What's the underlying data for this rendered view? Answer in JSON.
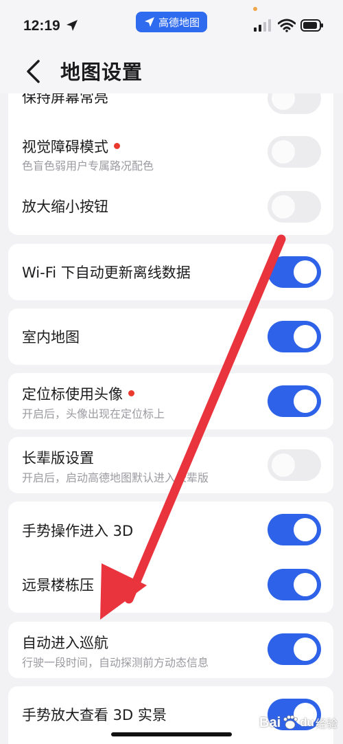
{
  "status": {
    "time": "12:19",
    "app_badge": "高德地图"
  },
  "header": {
    "title": "地图设置"
  },
  "settings": {
    "keep_screen_on": {
      "title": "保持屏幕常亮",
      "enabled": false
    },
    "visual_impairment": {
      "title": "视觉障碍模式",
      "subtitle": "色盲色弱用户专属路况配色",
      "enabled": false,
      "new_dot": true
    },
    "zoom_buttons": {
      "title": "放大缩小按钮",
      "enabled": false
    },
    "wifi_offline_update": {
      "title": "Wi-Fi 下自动更新离线数据",
      "enabled": true
    },
    "indoor_map": {
      "title": "室内地图",
      "enabled": true
    },
    "avatar_location": {
      "title": "定位标使用头像",
      "subtitle": "开启后，头像出现在定位标上",
      "enabled": true,
      "new_dot": true
    },
    "elder_mode": {
      "title": "长辈版设置",
      "subtitle": "开启后，启动高德地图默认进入长辈版",
      "enabled": false
    },
    "gesture_3d": {
      "title": "手势操作进入 3D",
      "enabled": true
    },
    "distant_buildings": {
      "title": "远景楼栋压",
      "enabled": true
    },
    "auto_cruise": {
      "title": "自动进入巡航",
      "subtitle": "行驶一段时间，自动探测前方动态信息",
      "enabled": true
    },
    "gesture_zoom_3d": {
      "title": "手势放大查看 3D 实景",
      "enabled": true
    }
  },
  "watermark": {
    "brand": "Bai",
    "brand_mark": "du",
    "suffix": "经验"
  },
  "colors": {
    "accent": "#2e62e8",
    "toggle_off": "#ececef",
    "badge_blue": "#2f6bef",
    "red_dot": "#ea3a2e",
    "arrow_red": "#e9343d",
    "background": "#f2f2f5"
  }
}
